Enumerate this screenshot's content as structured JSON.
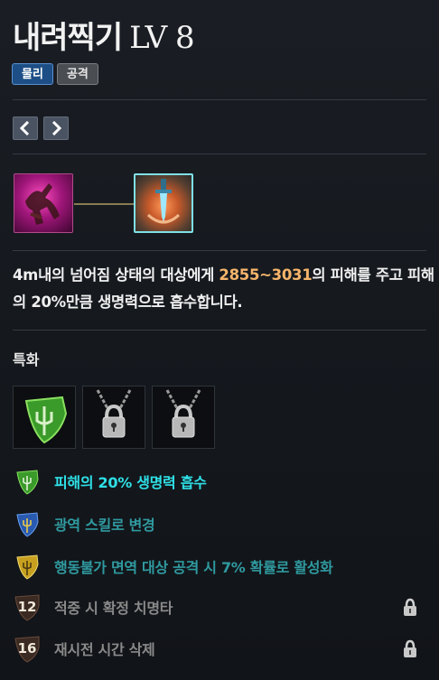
{
  "skill": {
    "name": "내려찍기",
    "level": "LV 8"
  },
  "tags": [
    {
      "label": "물리",
      "color": "#1d4f86"
    },
    {
      "label": "공격",
      "color": "#4a4d52"
    }
  ],
  "nav": {
    "prev_icon": "chevron-left-icon",
    "next_icon": "chevron-right-icon"
  },
  "tripod_icons": [
    "falling-body-icon",
    "sword-strike-icon"
  ],
  "description": {
    "before": "4m내의 넘어짐 상태의 대상에게 ",
    "highlight": "2855~3031",
    "after": "의 피해를 주고 피해의 20%만큼 생명력으로 흡수합니다.",
    "highlight_color": "#f5b46a"
  },
  "specialization": {
    "label": "특화",
    "slots": [
      "green-trident-shield-icon",
      "lock-icon",
      "lock-icon"
    ],
    "options": [
      {
        "text": "피해의 20% 생명력 흡수",
        "color": "#2ee0e6",
        "icon": "green-trident-shield-icon",
        "locked": false
      },
      {
        "text": "광역 스킬로 변경",
        "color": "#2f9aa0",
        "icon": "blue-trident-shield-icon",
        "locked": false
      },
      {
        "text": "행동불가 면역 대상 공격 시 7% 확률로 활성화",
        "color": "#2f9aa0",
        "icon": "gold-trident-shield-icon",
        "locked": false
      },
      {
        "text": "적중 시 확정 치명타",
        "level": "12",
        "color": "#8a8a8a",
        "icon": "level-shield-icon",
        "locked": true
      },
      {
        "text": "재시전 시간 삭제",
        "level": "16",
        "color": "#8a8a8a",
        "icon": "level-shield-icon",
        "locked": true
      }
    ]
  }
}
